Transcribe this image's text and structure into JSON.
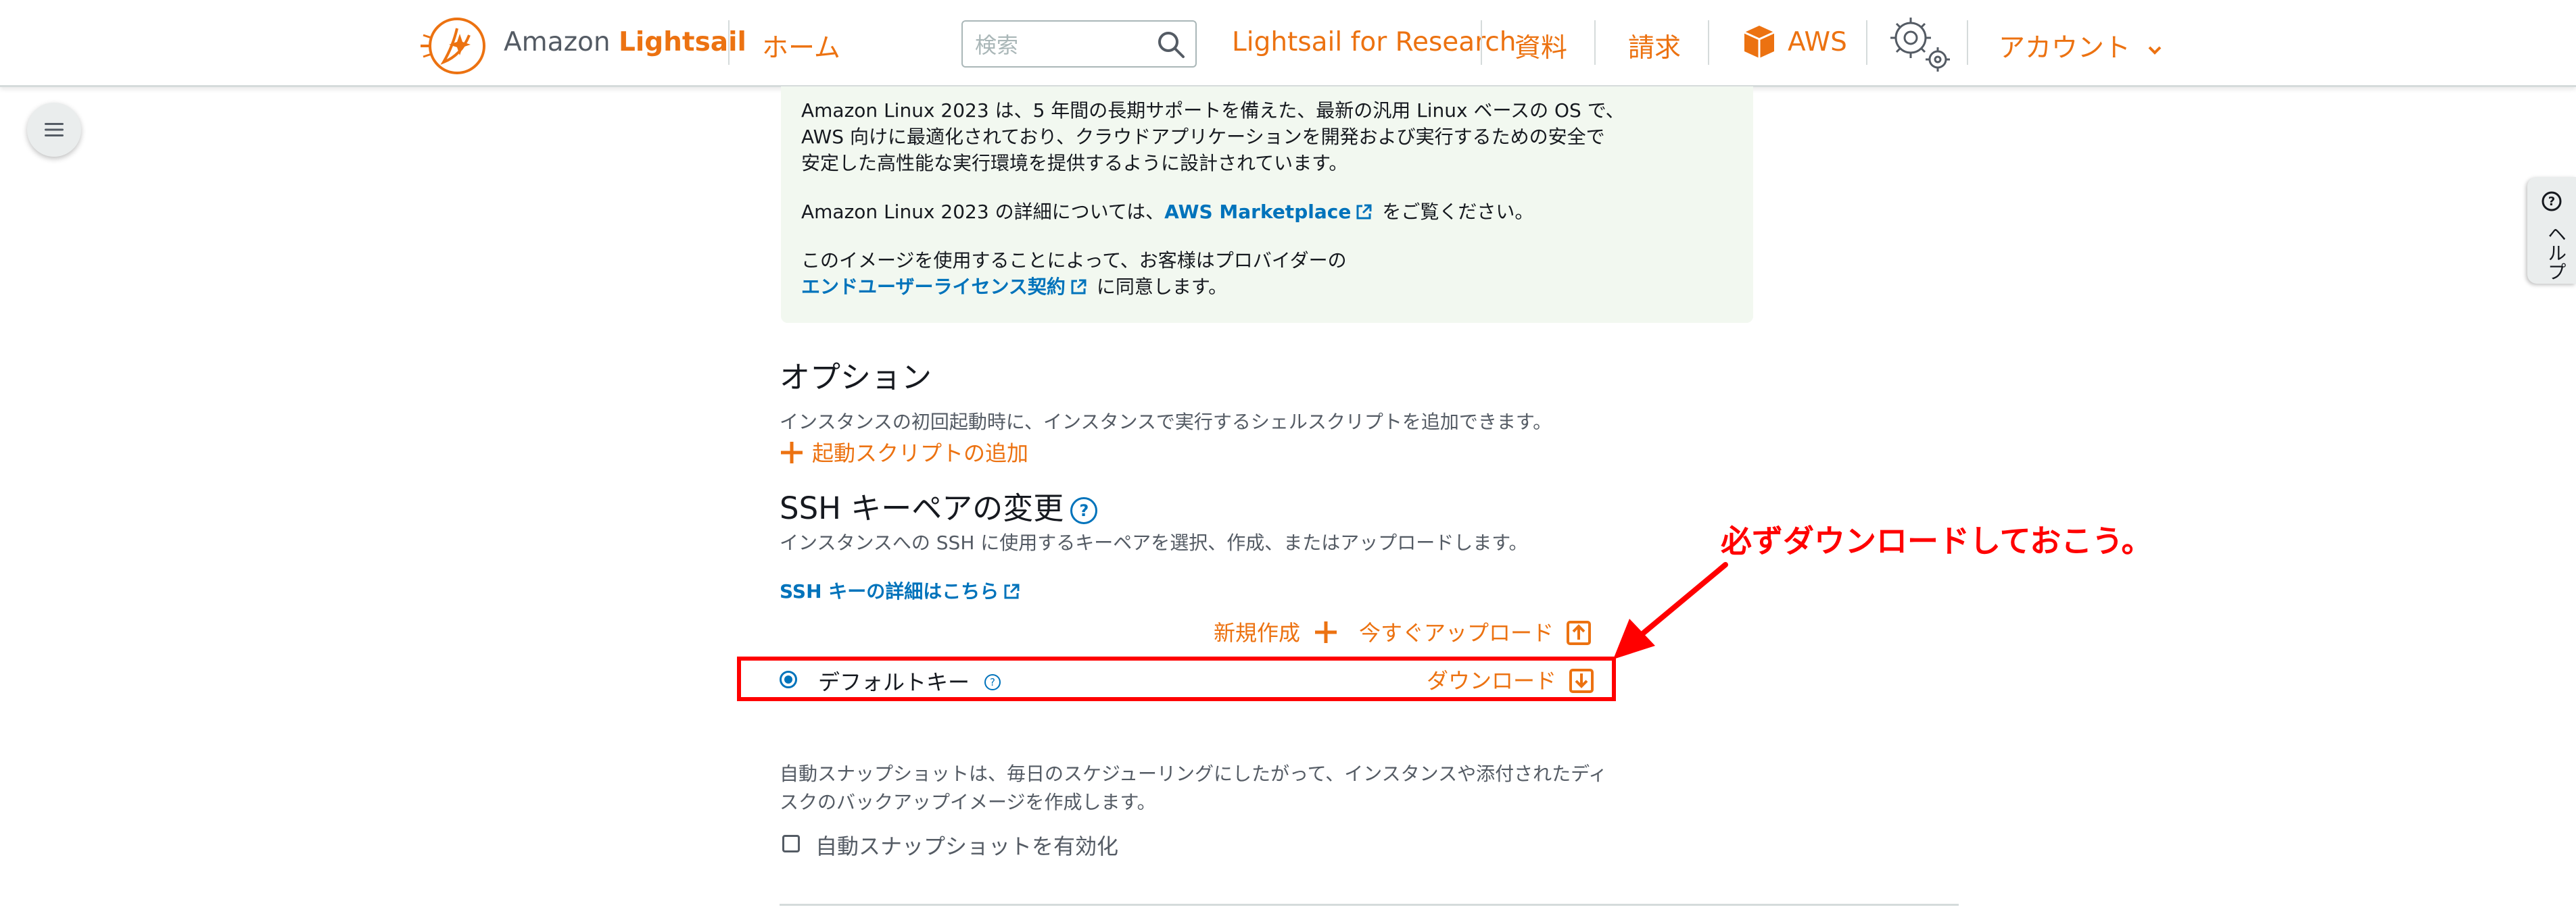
{
  "header": {
    "brand_prefix": "Amazon",
    "brand_name": "Lightsail",
    "home": "ホーム",
    "search_placeholder": "検索",
    "research": "Lightsail for Research",
    "docs": "資料",
    "billing": "請求",
    "aws": "AWS",
    "account": "アカウント"
  },
  "help_tab": {
    "label": "ヘルプ"
  },
  "info": {
    "p1_line1": "Amazon Linux 2023 は、5 年間の長期サポートを備えた、最新の汎用 Linux ベースの OS で、",
    "p1_line2": "AWS 向けに最適化されており、クラウドアプリケーションを開発および実行するための安全で",
    "p1_line3": "安定した高性能な実行環境を提供するように設計されています。",
    "p2_prefix": "Amazon Linux 2023 の詳細については、",
    "p2_link": "AWS Marketplace",
    "p2_suffix": "をご覧ください。",
    "p3_line1": "このイメージを使用することによって、お客様はプロバイダーの",
    "p3_link": "エンドユーザーライセンス契約",
    "p3_suffix": "に同意します。"
  },
  "options": {
    "title": "オプション",
    "desc": "インスタンスの初回起動時に、インスタンスで実行するシェルスクリプトを追加できます。",
    "add_script": "起動スクリプトの追加"
  },
  "ssh": {
    "title": "SSH キーペアの変更",
    "help": "?",
    "desc": "インスタンスへの SSH に使用するキーペアを選択、作成、またはアップロードします。",
    "details_link": "SSH キーの詳細はこちら",
    "create_new": "新規作成",
    "upload_now": "今すぐアップロード",
    "default_key": "デフォルトキー",
    "default_key_help": "?",
    "download": "ダウンロード"
  },
  "snapshot": {
    "desc_line1": "自動スナップショットは、毎日のスケジューリングにしたがって、インスタンスや添付されたディ",
    "desc_line2": "スクのバックアップイメージを作成します。",
    "enable_label": "自動スナップショットを有効化",
    "enabled": false
  },
  "annotation": {
    "text": "必ずダウンロードしておこう。"
  },
  "colors": {
    "accent": "#ec7211",
    "link": "#0073bb",
    "annotation": "#ff0000",
    "info_bg": "#f2f8f0"
  }
}
